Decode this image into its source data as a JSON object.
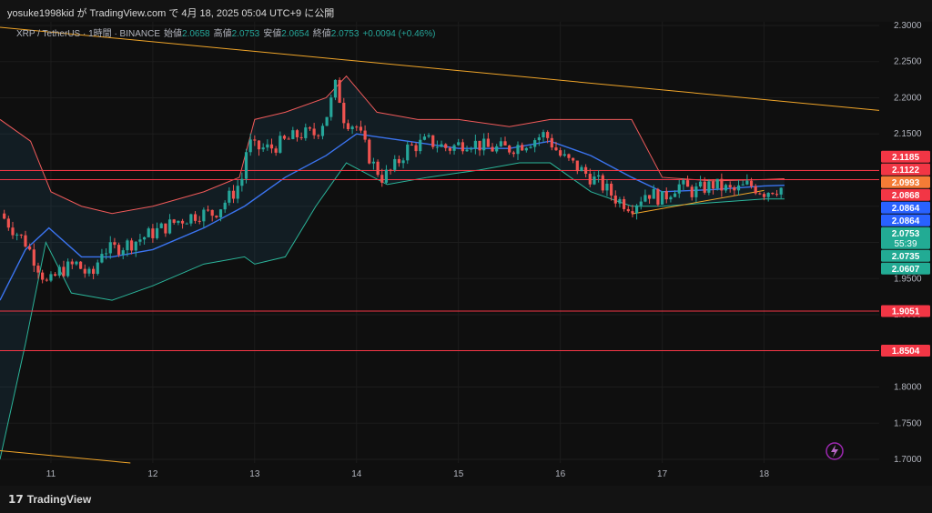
{
  "header": {
    "publish_text": "yosuke1998kid が TradingView.com で 4月 18, 2025 05:04 UTC+9 に公開"
  },
  "legend": {
    "symbol": "XRP / TetherUS · 1時間 · BINANCE",
    "open_label": "始値",
    "open_value": "2.0658",
    "high_label": "高値",
    "high_value": "2.0753",
    "low_label": "安値",
    "low_value": "2.0654",
    "close_label": "終値",
    "close_value": "2.0753",
    "change": "+0.0094 (+0.46%)"
  },
  "footer": {
    "brand": "TradingView"
  },
  "colors": {
    "up": "#26a69a",
    "down": "#ef5350",
    "bb_upper": "#f05a5a",
    "bb_basis": "#3b74f0",
    "bb_lower": "#2bb59a",
    "trendline": "#f0a529",
    "hline": "#f23645",
    "countdown": "#22ab94"
  },
  "chart_data": {
    "type": "candlestick",
    "timeframe": "1時間",
    "exchange": "BINANCE",
    "pair": "XRP / TetherUS",
    "ylim": [
      1.695,
      2.305
    ],
    "xlim": [
      10.5,
      19.13
    ],
    "y_ticks": [
      1.7,
      1.75,
      1.8,
      1.85,
      1.9,
      1.95,
      2.0,
      2.05,
      2.1,
      2.15,
      2.2,
      2.25,
      2.3
    ],
    "x_ticks": [
      {
        "value": 11,
        "label": "11"
      },
      {
        "value": 12,
        "label": "12"
      },
      {
        "value": 13,
        "label": "13"
      },
      {
        "value": 14,
        "label": "14"
      },
      {
        "value": 15,
        "label": "15"
      },
      {
        "value": 16,
        "label": "16"
      },
      {
        "value": 17,
        "label": "17"
      },
      {
        "value": 18,
        "label": "18"
      }
    ],
    "price_path": [
      [
        10.5,
        2.04
      ],
      [
        10.62,
        2.02
      ],
      [
        10.75,
        2.0
      ],
      [
        10.9,
        1.96
      ],
      [
        10.97,
        1.94
      ],
      [
        11.08,
        1.96
      ],
      [
        11.25,
        1.97
      ],
      [
        11.4,
        1.95
      ],
      [
        11.5,
        1.99
      ],
      [
        11.6,
        1.99
      ],
      [
        11.8,
        2.0
      ],
      [
        11.95,
        2.01
      ],
      [
        12.1,
        2.02
      ],
      [
        12.25,
        2.03
      ],
      [
        12.45,
        2.04
      ],
      [
        12.6,
        2.04
      ],
      [
        12.8,
        2.07
      ],
      [
        12.88,
        2.09
      ],
      [
        12.93,
        2.14
      ],
      [
        13.0,
        2.13
      ],
      [
        13.15,
        2.13
      ],
      [
        13.3,
        2.14
      ],
      [
        13.45,
        2.15
      ],
      [
        13.6,
        2.15
      ],
      [
        13.72,
        2.18
      ],
      [
        13.8,
        2.22
      ],
      [
        13.88,
        2.17
      ],
      [
        14.0,
        2.16
      ],
      [
        14.15,
        2.11
      ],
      [
        14.25,
        2.09
      ],
      [
        14.35,
        2.1
      ],
      [
        14.5,
        2.13
      ],
      [
        14.7,
        2.14
      ],
      [
        14.9,
        2.13
      ],
      [
        15.1,
        2.14
      ],
      [
        15.3,
        2.13
      ],
      [
        15.5,
        2.13
      ],
      [
        15.7,
        2.14
      ],
      [
        15.85,
        2.15
      ],
      [
        16.0,
        2.12
      ],
      [
        16.2,
        2.1
      ],
      [
        16.4,
        2.08
      ],
      [
        16.55,
        2.06
      ],
      [
        16.7,
        2.05
      ],
      [
        16.85,
        2.07
      ],
      [
        17.0,
        2.06
      ],
      [
        17.15,
        2.08
      ],
      [
        17.3,
        2.07
      ],
      [
        17.5,
        2.08
      ],
      [
        17.7,
        2.07
      ],
      [
        17.85,
        2.08
      ],
      [
        18.0,
        2.07
      ],
      [
        18.1,
        2.075
      ],
      [
        18.2,
        2.0753
      ]
    ],
    "bollinger_bands": {
      "upper": [
        [
          10.5,
          2.17
        ],
        [
          10.8,
          2.14
        ],
        [
          11.0,
          2.07
        ],
        [
          11.3,
          2.05
        ],
        [
          11.6,
          2.04
        ],
        [
          12.0,
          2.05
        ],
        [
          12.5,
          2.07
        ],
        [
          12.85,
          2.09
        ],
        [
          13.0,
          2.17
        ],
        [
          13.3,
          2.18
        ],
        [
          13.7,
          2.2
        ],
        [
          13.9,
          2.23
        ],
        [
          14.2,
          2.18
        ],
        [
          14.6,
          2.17
        ],
        [
          15.0,
          2.17
        ],
        [
          15.5,
          2.16
        ],
        [
          15.9,
          2.17
        ],
        [
          16.3,
          2.17
        ],
        [
          16.7,
          2.17
        ],
        [
          17.0,
          2.09
        ],
        [
          17.5,
          2.085
        ],
        [
          18.0,
          2.087
        ],
        [
          18.2,
          2.088
        ]
      ],
      "basis": [
        [
          10.5,
          1.92
        ],
        [
          10.75,
          1.99
        ],
        [
          10.98,
          2.02
        ],
        [
          11.3,
          1.98
        ],
        [
          11.6,
          1.98
        ],
        [
          12.0,
          1.99
        ],
        [
          12.5,
          2.02
        ],
        [
          12.9,
          2.05
        ],
        [
          13.3,
          2.09
        ],
        [
          13.7,
          2.12
        ],
        [
          14.0,
          2.15
        ],
        [
          14.5,
          2.14
        ],
        [
          15.0,
          2.13
        ],
        [
          15.5,
          2.13
        ],
        [
          15.9,
          2.14
        ],
        [
          16.3,
          2.12
        ],
        [
          16.7,
          2.09
        ],
        [
          17.0,
          2.07
        ],
        [
          17.5,
          2.073
        ],
        [
          18.0,
          2.078
        ],
        [
          18.2,
          2.079
        ]
      ],
      "lower": [
        [
          10.5,
          1.7
        ],
        [
          10.75,
          1.86
        ],
        [
          10.95,
          2.0
        ],
        [
          11.2,
          1.93
        ],
        [
          11.6,
          1.92
        ],
        [
          12.0,
          1.94
        ],
        [
          12.5,
          1.97
        ],
        [
          12.9,
          1.98
        ],
        [
          13.0,
          1.97
        ],
        [
          13.3,
          1.98
        ],
        [
          13.6,
          2.05
        ],
        [
          13.9,
          2.11
        ],
        [
          14.3,
          2.08
        ],
        [
          14.7,
          2.09
        ],
        [
          15.2,
          2.1
        ],
        [
          15.6,
          2.11
        ],
        [
          15.9,
          2.11
        ],
        [
          16.3,
          2.07
        ],
        [
          16.7,
          2.05
        ],
        [
          17.0,
          2.05
        ],
        [
          17.5,
          2.055
        ],
        [
          18.0,
          2.06
        ],
        [
          18.2,
          2.06
        ]
      ]
    },
    "horizontal_lines": [
      2.0868,
      2.0993,
      1.9051,
      1.8504
    ],
    "trendlines": [
      {
        "from": [
          10.5,
          2.2975
        ],
        "to": [
          19.13,
          2.1825
        ]
      },
      {
        "from": [
          10.5,
          1.712
        ],
        "to": [
          11.78,
          1.695
        ]
      },
      {
        "from": [
          16.7,
          2.0393
        ],
        "to": [
          18.0,
          2.0718
        ]
      }
    ],
    "price_labels": [
      {
        "value": "2.1185",
        "y": 2.1185,
        "bg": "#f23645",
        "fg": "#ffffff"
      },
      {
        "value": "2.1122",
        "y": 2.1122,
        "bg": "#f23645",
        "fg": "#ffffff"
      },
      {
        "value": "2.0993",
        "y": 2.0993,
        "bg": "#f57c36",
        "fg": "#ffffff"
      },
      {
        "value": "2.0868",
        "y": 2.0868,
        "bg": "#f23645",
        "fg": "#ffffff"
      },
      {
        "value": "2.0864",
        "y": 2.0864,
        "bg": "#2962ff",
        "fg": "#ffffff"
      },
      {
        "value": "2.0864",
        "y": 2.0864,
        "bg": "#2962ff",
        "fg": "#ffffff"
      },
      {
        "value": "2.0753",
        "y": 2.0753,
        "bg": "#22ab94",
        "fg": "#ffffff",
        "sub": "55:39"
      },
      {
        "value": "2.0735",
        "y": 2.0735,
        "bg": "#22ab94",
        "fg": "#ffffff"
      },
      {
        "value": "2.0607",
        "y": 2.0607,
        "bg": "#22ab94",
        "fg": "#ffffff"
      },
      {
        "value": "1.9051",
        "y": 1.9051,
        "bg": "#f23645",
        "fg": "#ffffff"
      },
      {
        "value": "1.8504",
        "y": 1.8504,
        "bg": "#f23645",
        "fg": "#ffffff"
      }
    ]
  }
}
